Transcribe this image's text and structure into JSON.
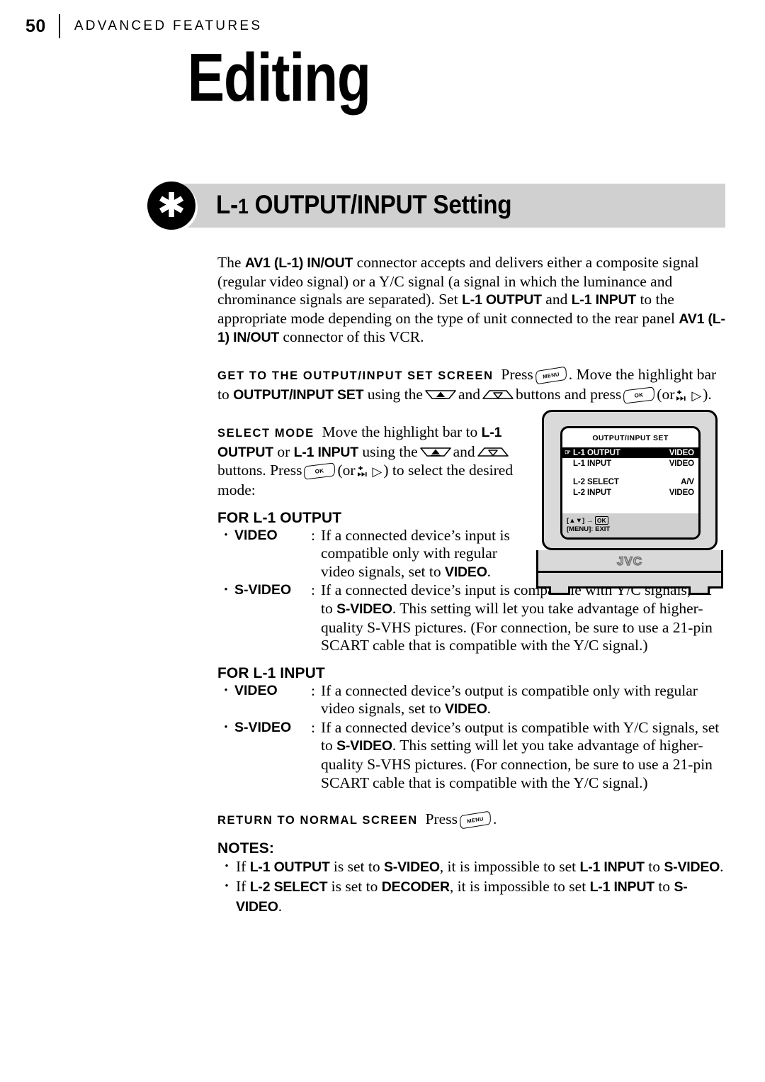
{
  "header": {
    "page_number": "50",
    "section": "ADVANCED FEATURES"
  },
  "chapter_title": "Editing",
  "banner": {
    "icon": "asterisk-icon",
    "title_main": "OUTPUT/INPUT Setting",
    "title_prefix": "L-",
    "title_prefix_sub": "1"
  },
  "intro": {
    "text_1": "The ",
    "bold_1": "AV1 (L-1) IN/OUT",
    "text_2": " connector accepts and delivers either a composite signal (regular video signal) or a Y/C signal (a signal in which the luminance and chrominance signals are separated). Set ",
    "bold_2": "L-1 OUTPUT",
    "text_3": " and ",
    "bold_3": "L-1 INPUT",
    "text_4": " to the appropriate mode depending on the type of unit connected to the rear panel ",
    "bold_4": "AV1 (L-1) IN/OUT",
    "text_5": " connector of this VCR."
  },
  "step_get": {
    "label": "GET TO THE OUTPUT/INPUT SET SCREEN",
    "text_1": "Press",
    "button_1": "MENU",
    "text_2": ". Move the highlight bar to",
    "bold_1": "OUTPUT/INPUT SET",
    "text_3": "using the",
    "button_up": "up-arrow-button",
    "text_4": "and",
    "button_down": "down-arrow-button",
    "text_5": "buttons and press",
    "button_2": "OK",
    "text_6": "(or",
    "glyph_skip": "skip-forward-icon",
    "glyph_play": "▷",
    "text_7": ")."
  },
  "step_select": {
    "label": "SELECT MODE",
    "text_1": "Move the highlight bar to",
    "bold_1": "L-1 OUTPUT",
    "text_2": "or",
    "bold_2": "L-1 INPUT",
    "text_3": "using the",
    "text_4": "and",
    "text_5": "buttons. Press",
    "text_6": "(or",
    "text_7": ") to select the desired mode:"
  },
  "for_output": {
    "heading": "FOR L-1 OUTPUT",
    "items": [
      {
        "bullet": "•",
        "term": "VIDEO",
        "colon": ":",
        "desc_1": "If a connected device’s input is compatible only with regular video signals, set to ",
        "desc_bold": "VIDEO",
        "desc_2": "."
      },
      {
        "bullet": "•",
        "term": "S-VIDEO",
        "colon": ":",
        "desc_1": "If a connected device’s input is compatible with Y/C signals, set to ",
        "desc_bold": "S-VIDEO",
        "desc_2": ". This setting will let you take advantage of higher-quality S-VHS pictures. (For connection, be sure to use a 21-pin SCART cable that is compatible with the Y/C signal.)"
      }
    ]
  },
  "for_input": {
    "heading": "FOR L-1 INPUT",
    "items": [
      {
        "bullet": "•",
        "term": "VIDEO",
        "colon": ":",
        "desc_1": "If a connected device’s output is compatible only with regular video signals, set to ",
        "desc_bold": "VIDEO",
        "desc_2": "."
      },
      {
        "bullet": "•",
        "term": "S-VIDEO",
        "colon": ":",
        "desc_1": "If a connected device’s output is compatible with Y/C signals, set to ",
        "desc_bold": "S-VIDEO",
        "desc_2": ". This setting will let you take advantage of higher-quality S-VHS pictures. (For connection, be sure to use a 21-pin SCART cable that is compatible with the Y/C signal.)"
      }
    ]
  },
  "step_return": {
    "label": "RETURN TO NORMAL SCREEN",
    "text_1": "Press",
    "button": "MENU",
    "text_2": "."
  },
  "notes": {
    "heading": "NOTES:",
    "items": [
      {
        "bullet": "•",
        "t1": "If ",
        "b1": "L-1 OUTPUT",
        "t2": " is set to ",
        "b2": "S-VIDEO",
        "t3": ", it is impossible to set ",
        "b3": "L-1 INPUT",
        "t4": " to ",
        "b4": "S-VIDEO",
        "t5": "."
      },
      {
        "bullet": "•",
        "t1": "If ",
        "b1": "L-2 SELECT",
        "t2": " is set to ",
        "b2": "DECODER",
        "t3": ", it is impossible to set ",
        "b3": "L-1 INPUT",
        "t4": " to ",
        "b4": "S-VIDEO",
        "t5": "."
      }
    ]
  },
  "tv": {
    "brand": "JVC",
    "osd": {
      "title": "OUTPUT/INPUT SET",
      "pointer_glyph": "☞",
      "rows": [
        {
          "label": "L-1 OUTPUT",
          "value": "VIDEO",
          "selected": true
        },
        {
          "label": "L-1 INPUT",
          "value": "VIDEO",
          "selected": false
        },
        {
          "label": "L-2 SELECT",
          "value": "A/V",
          "selected": false
        },
        {
          "label": "L-2 INPUT",
          "value": "VIDEO",
          "selected": false
        }
      ],
      "footer_line1_pre": "[▲▼] → ",
      "footer_line1_ok": "OK",
      "footer_line2": "[MENU]: EXIT"
    }
  },
  "colors": {
    "banner_bg": "#d0d0d0",
    "tv_body": "#d9d9d9",
    "osd_footer": "#cfcfcf",
    "ink": "#000000"
  }
}
